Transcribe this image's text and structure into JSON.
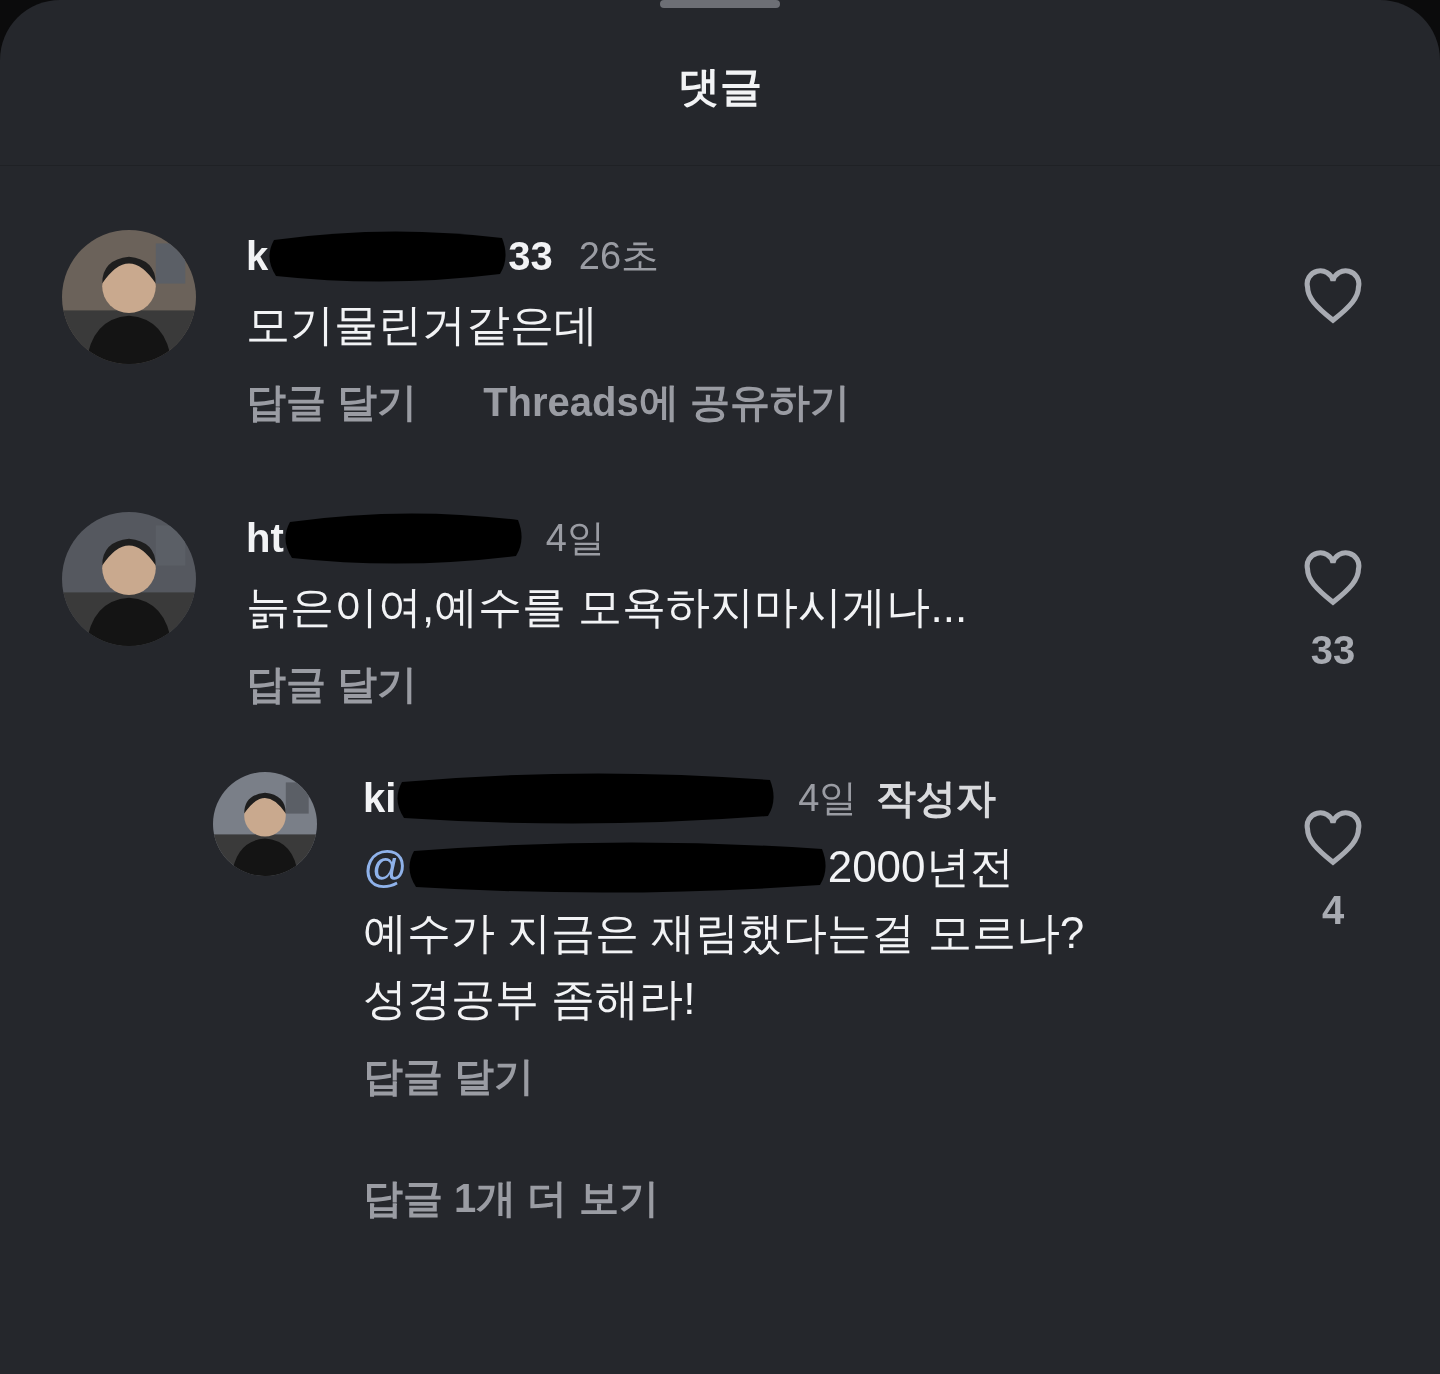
{
  "sheet": {
    "title": "댓글"
  },
  "comments": [
    {
      "kind": "comment",
      "name_start": "k",
      "name_end": "33",
      "time": "26초",
      "lines": [
        "모기물린거같은데"
      ],
      "actions": [
        "답글 달기",
        "Threads에 공유하기"
      ],
      "liked": false
    },
    {
      "kind": "comment",
      "name_start": "ht",
      "time": "4일",
      "lines": [
        "늙은이여,예수를 모욕하지마시게나..."
      ],
      "actions": [
        "답글 달기"
      ],
      "liked": false,
      "like_count": "33"
    },
    {
      "kind": "reply",
      "name_start": "ki",
      "time": "4일",
      "badge": "작성자",
      "mention": "@",
      "mention_tail": "2000년전",
      "lines": [
        "예수가 지금은 재림했다는걸 모르나?",
        "성경공부 좀해라!"
      ],
      "actions": [
        "답글 달기"
      ],
      "liked": false,
      "like_count": "4"
    }
  ],
  "more_replies": "답글 1개 더 보기"
}
